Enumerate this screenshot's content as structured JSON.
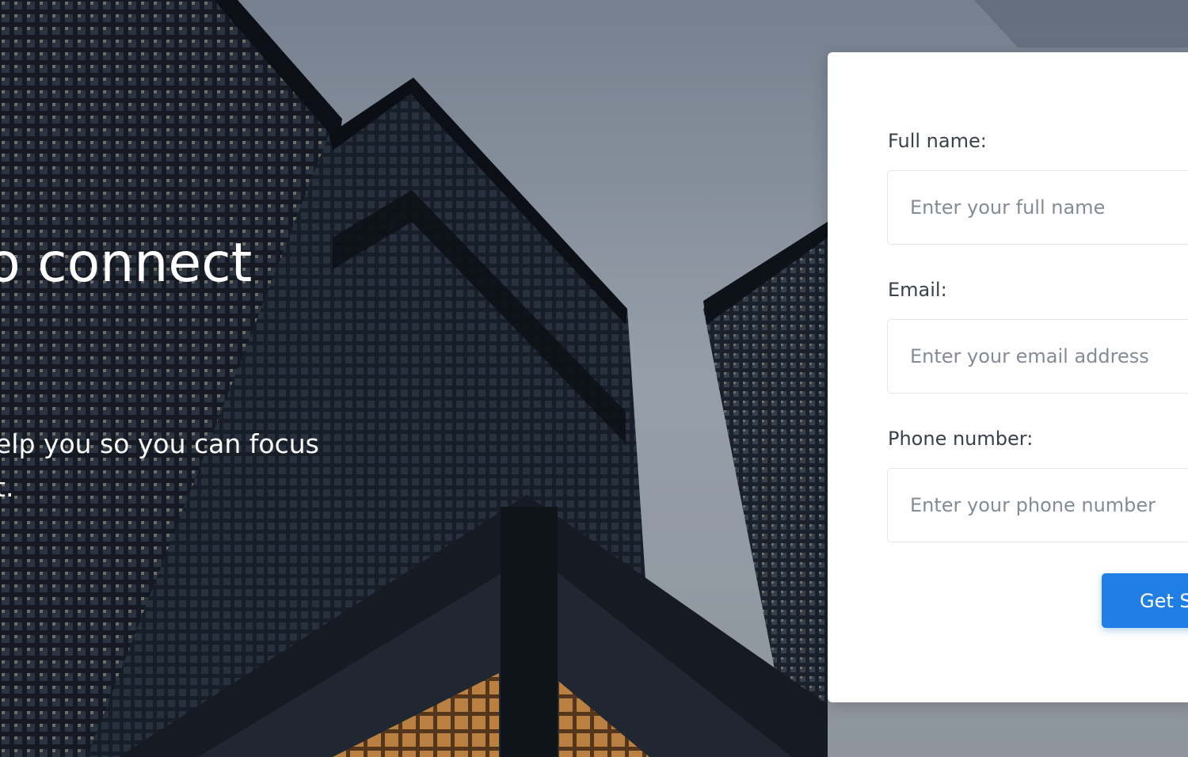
{
  "hero": {
    "heading": "o connect",
    "description": "elp you so you can focus\nt."
  },
  "form": {
    "full_name": {
      "label": "Full name:",
      "placeholder": "Enter your full name"
    },
    "email": {
      "label": "Email:",
      "placeholder": "Enter your email address"
    },
    "phone": {
      "label": "Phone number:",
      "placeholder": "Enter your phone number"
    },
    "submit_label": "Get S"
  },
  "colors": {
    "primary_button": "#1f7fe6",
    "card_background": "#ffffff",
    "label_text": "#3b4149",
    "placeholder_text": "#858b93"
  }
}
